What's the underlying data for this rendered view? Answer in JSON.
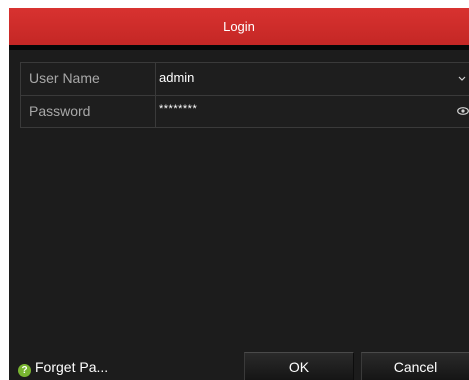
{
  "dialog": {
    "title": "Login"
  },
  "form": {
    "username_label": "User Name",
    "username_value": "admin",
    "password_label": "Password",
    "password_value": "********"
  },
  "footer": {
    "forget_label": "Forget Pa...",
    "help_glyph": "?",
    "ok_label": "OK",
    "cancel_label": "Cancel"
  },
  "colors": {
    "title_bar": "#d32f2f",
    "dialog_bg": "#1c1c1c",
    "help_icon": "#79b531"
  },
  "icons": {
    "username_dropdown": "chevron-down-icon",
    "password_reveal": "eye-icon",
    "forget_password": "help-icon"
  }
}
